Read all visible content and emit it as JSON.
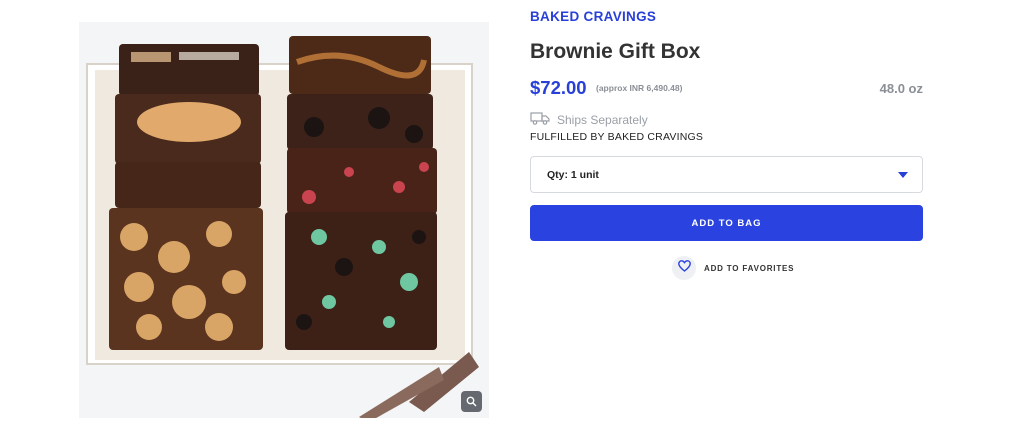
{
  "product": {
    "brand": "BAKED CRAVINGS",
    "title": "Brownie Gift Box",
    "price": "$72.00",
    "price_approx": "(approx INR 6,490.48)",
    "weight": "48.0 oz",
    "ships_label": "Ships Separately",
    "fulfilled_by": "FULFILLED BY BAKED CRAVINGS"
  },
  "quantity": {
    "selected": "Qty: 1 unit"
  },
  "actions": {
    "add_to_bag": "ADD TO BAG",
    "add_to_favorites": "ADD TO FAVORITES"
  },
  "icons": {
    "zoom": "magnifier-icon",
    "ships": "truck-icon",
    "favorite": "heart-icon",
    "dropdown": "caret-down-icon"
  },
  "colors": {
    "accent": "#2a43e0",
    "muted_text": "#8a8f96"
  }
}
